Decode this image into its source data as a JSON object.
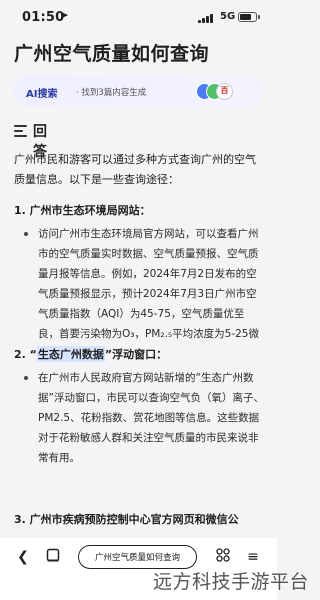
{
  "status_bar": {
    "time": "01:50",
    "network": "5G"
  },
  "page_title": "广州空气质量如何查询",
  "ai_search": {
    "label": "AI搜索",
    "summary": "· 找到3篇内容生成",
    "badge": "百"
  },
  "answer": {
    "heading": "回答",
    "intro": "广州市民和游客可以通过多种方式查询广州的空气质量信息。以下是一些查询途径：",
    "sections": [
      {
        "title": "1. 广州市生态环境局网站：",
        "quote_open": "",
        "quote": "",
        "quote_close": "",
        "bullet": "访问广州市生态环境局官方网站，可以查看广州市的空气质量实时数据、空气质量预报、空气质量月报等信息。例如，2024年7月2日发布的空气质量预报显示，预计2024年7月3日广州市空气质量指数（AQI）为45-75，空气质量优至良，首要污染物为O₃，PM₂.₅平均浓度为5-25微克/立方米。"
      },
      {
        "title": "",
        "quote_open": "2. “",
        "quote": "生态广州数据",
        "quote_close": "”浮动窗口：",
        "bullet": "在广州市人民政府官方网站新增的“生态广州数据”浮动窗口，市民可以查询空气负（氧）离子、PM2.5、花粉指数、赏花地图等信息。这些数据对于花粉敏感人群和关注空气质量的市民来说非常有用。"
      },
      {
        "title": "3. 广州市疾病预防控制中心官方网页和微信公",
        "quote_open": "",
        "quote": "",
        "quote_close": "",
        "bullet": ""
      }
    ]
  },
  "bottom_bar": {
    "back_icon": "chevron-left-icon",
    "page_title_pill": "广州空气质量如何查询",
    "tabs_icon": "tabs-grid-icon",
    "more_icon": "more-icon"
  },
  "watermark": "远方科技手游平台",
  "colors": {
    "background": "#f4f4f6",
    "highlight": "#d6e4ff",
    "ai_accent": "#2c3b9c"
  },
  "battery_level": 0.75
}
